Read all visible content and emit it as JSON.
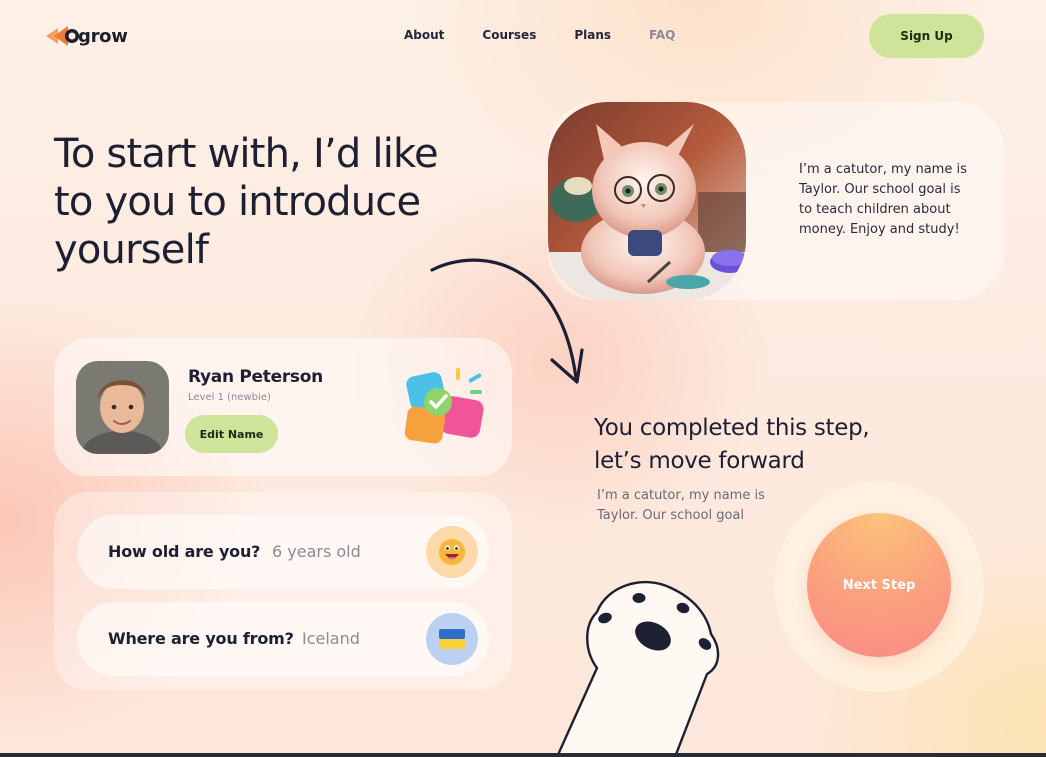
{
  "brand": {
    "name": "grow"
  },
  "nav": {
    "items": [
      "About",
      "Courses",
      "Plans",
      "FAQ"
    ]
  },
  "header": {
    "signup_label": "Sign Up"
  },
  "hero": {
    "title": "To start with, I’d like to you to introduce yourself"
  },
  "tutor": {
    "text": "I’m a catutor, my name is Taylor. Our school goal is to teach children about money. Enjoy and study!"
  },
  "profile": {
    "name": "Ryan Peterson",
    "level": "Level 1 (newbie)",
    "edit_label": "Edit Name"
  },
  "questions": [
    {
      "label": "How old are you?",
      "value": "6 years old",
      "icon": "grinning-face-icon"
    },
    {
      "label": "Where are you from?",
      "value": "Iceland",
      "icon": "flag-icon"
    }
  ],
  "step": {
    "title": "You completed this step, let’s move forward",
    "text": "I’m a catutor, my name is Taylor. Our school goal",
    "next_label": "Next Step"
  },
  "colors": {
    "accent_green": "#cde49a",
    "next_orange": "#fba07e",
    "text_dark": "#1d1f33"
  }
}
